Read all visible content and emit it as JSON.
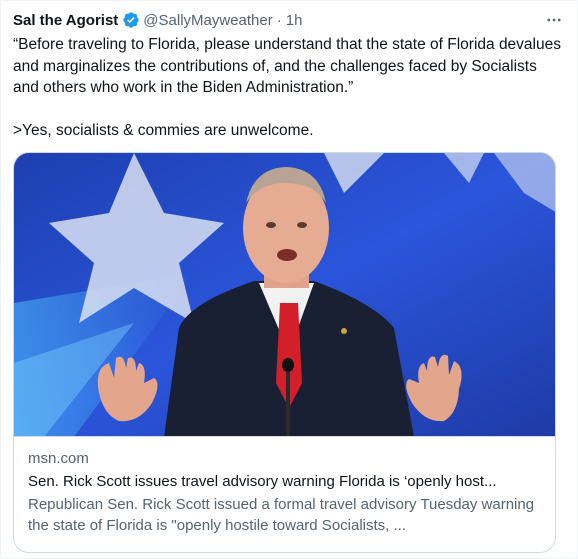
{
  "tweet": {
    "author_name": "Sal the Agorist",
    "handle": "@SallyMayweather",
    "separator": "·",
    "time": "1h",
    "verified_icon": "verified-badge-icon",
    "more_icon": "more-options-icon",
    "text_line1": "“Before traveling to Florida, please understand that the state of Florida devalues and marginalizes the contributions of, and the challenges faced by Socialists and others who work in the Biden Administration.”",
    "text_line2": ">Yes, socialists & commies are unwelcome."
  },
  "card": {
    "image_icon": "senator-speaking-photo",
    "domain": "msn.com",
    "title": "Sen. Rick Scott issues travel advisory warning Florida is ‘openly host...",
    "description": "Republican Sen. Rick Scott issued a formal travel advisory Tuesday warning the state of Florida is \"openly hostile toward Socialists, ..."
  },
  "colors": {
    "text_primary": "#0f1419",
    "text_secondary": "#536471",
    "verified_blue": "#1d9bf0",
    "border": "#cfd9de",
    "photo_background": "#2a52d6"
  }
}
